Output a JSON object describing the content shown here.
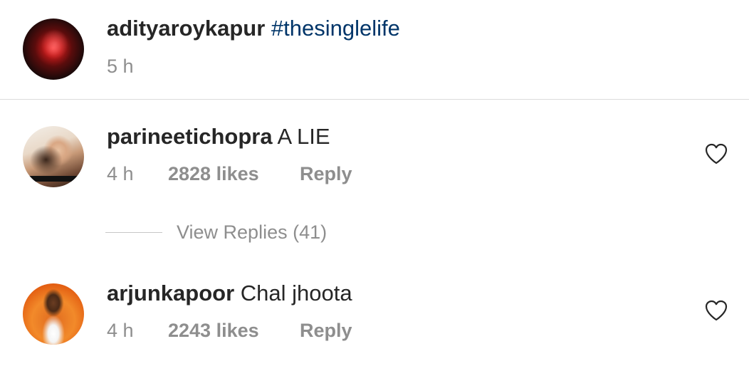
{
  "post": {
    "username": "adityaroykapur",
    "caption": "#thesinglelife",
    "time": "5 h"
  },
  "comments": [
    {
      "username": "parineetichopra",
      "text": "A LIE",
      "time": "4 h",
      "likes": "2828 likes",
      "reply_label": "Reply",
      "heart_icon": "heart-outline-icon"
    },
    {
      "username": "arjunkapoor",
      "text": "Chal jhoota",
      "time": "4 h",
      "likes": "2243 likes",
      "reply_label": "Reply",
      "heart_icon": "heart-outline-icon"
    }
  ],
  "view_replies": "View Replies (41)",
  "colors": {
    "text": "#262626",
    "muted": "#8e8e8e",
    "hashtag": "#003569",
    "divider": "#dbdbdb"
  }
}
